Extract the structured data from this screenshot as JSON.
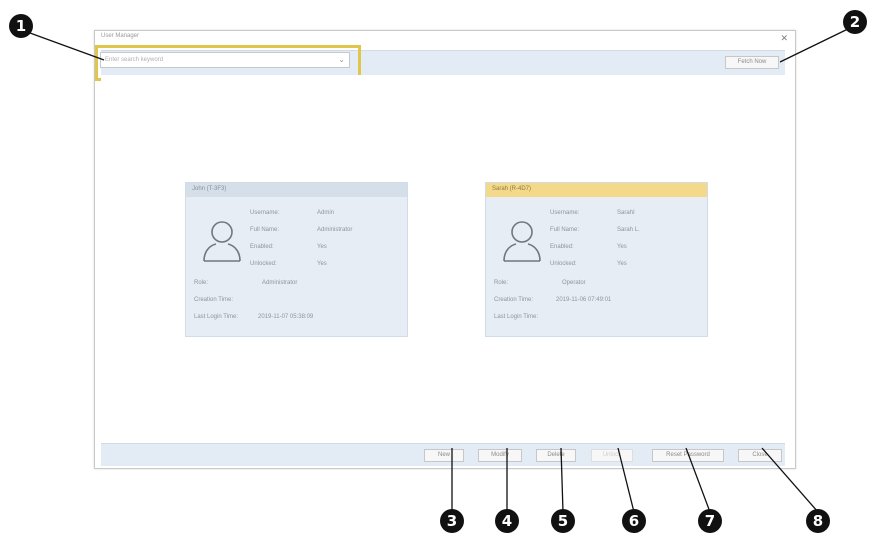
{
  "window": {
    "title": "User Manager",
    "close_icon": "close-icon"
  },
  "filter": {
    "placeholder": "Enter search keyword",
    "chevron_icon": "chevron-down-icon"
  },
  "toolbar": {
    "fetch_label": "Fetch Now"
  },
  "cards": [
    {
      "header": "John (T-3F3)",
      "rows": [
        {
          "label": "Username:",
          "value": "Admin"
        },
        {
          "label": "Full Name:",
          "value": "Administrator"
        },
        {
          "label": "Enabled:",
          "value": "Yes"
        },
        {
          "label": "Unlocked:",
          "value": "Yes"
        }
      ],
      "role_label": "Role:",
      "role_value": "Administrator",
      "creation_label": "Creation Time:",
      "creation_value": "",
      "last_login_label": "Last Login Time:",
      "last_login_value": "2019-11-07 05:38:09",
      "avatar_icon": "user-icon"
    },
    {
      "header": "Sarah (R-4D7)",
      "rows": [
        {
          "label": "Username:",
          "value": "SarahI"
        },
        {
          "label": "Full Name:",
          "value": "Sarah L."
        },
        {
          "label": "Enabled:",
          "value": "Yes"
        },
        {
          "label": "Unlocked:",
          "value": "Yes"
        }
      ],
      "role_label": "Role:",
      "role_value": "Operator",
      "creation_label": "Creation Time:",
      "creation_value": "2019-11-06 07:49:01",
      "last_login_label": "Last Login Time:",
      "last_login_value": "",
      "avatar_icon": "user-icon"
    }
  ],
  "footer": {
    "new_label": "New",
    "modify_label": "Modify",
    "delete_label": "Delete",
    "unlock_label": "Unlock",
    "reset_password_label": "Reset Password",
    "close_label": "Close"
  },
  "callouts": [
    "1",
    "2",
    "3",
    "4",
    "5",
    "6",
    "7",
    "8"
  ],
  "colors": {
    "highlight": "#e0c64a",
    "selected_header": "#f4d98a",
    "bar": "#e3ecf5",
    "callout": "#111111"
  }
}
